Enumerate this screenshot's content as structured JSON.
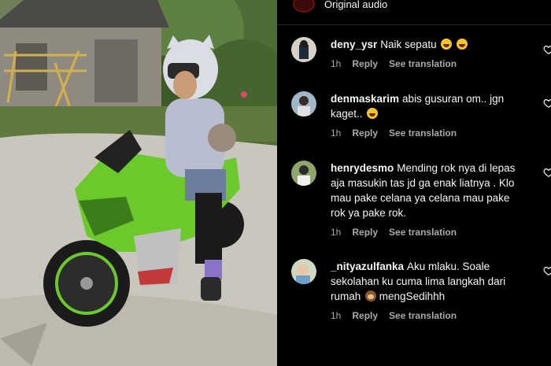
{
  "audio": {
    "label": "Original audio"
  },
  "comments": [
    {
      "username": "deny_ysr",
      "text": "Naik sepatu",
      "emojis": [
        "grinning-face-icon",
        "grinning-face-icon"
      ],
      "time": "1h",
      "reply": "Reply",
      "translate": "See translation"
    },
    {
      "username": "denmaskarim",
      "text": "abis gusuran om.. jgn kaget..",
      "emojis": [
        "grinning-face-icon"
      ],
      "time": "1h",
      "reply": "Reply",
      "translate": "See translation"
    },
    {
      "username": "henrydesmo",
      "text": "Mending rok nya di lepas aja masukin tas jd ga enak liatnya . Klo mau pake celana ya celana mau pake rok ya pake rok.",
      "emojis": [],
      "time": "1h",
      "reply": "Reply",
      "translate": "See translation"
    },
    {
      "username": "_nityazulfanka",
      "text": "Aku mlaku. Soale sekolahan ku cuma lima langkah dari rumah",
      "text_after": "mengSedihhh",
      "emojis": [
        "see-no-evil-monkey-icon"
      ],
      "time": "1h",
      "reply": "Reply",
      "translate": "See translation"
    }
  ],
  "colors": {
    "panel_bg": "#000000",
    "text": "#f5f5f5",
    "meta": "#a8a8a8",
    "bike_green": "#6cc92b"
  }
}
